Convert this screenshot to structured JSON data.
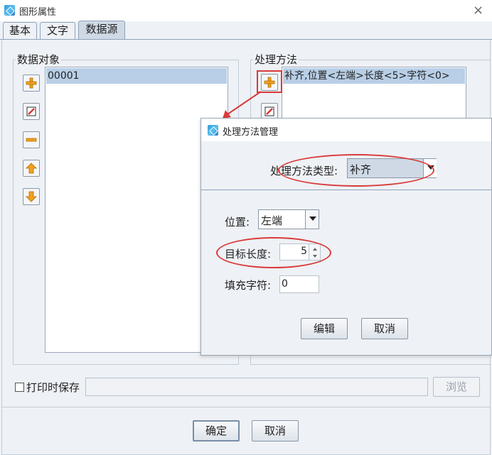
{
  "window": {
    "title": "图形属性",
    "close": "×"
  },
  "tabs": [
    {
      "label": "基本",
      "active": false
    },
    {
      "label": "文字",
      "active": false
    },
    {
      "label": "数据源",
      "active": true
    }
  ],
  "data_object": {
    "label": "数据对象",
    "items": [
      "00001"
    ]
  },
  "process_method": {
    "label": "处理方法",
    "items": [
      "补齐,位置<左端>长度<5>字符<0>"
    ]
  },
  "print_save": {
    "label": "打印时保存",
    "checked": false,
    "path": "",
    "browse_label": "浏览"
  },
  "footer": {
    "ok_label": "确定",
    "cancel_label": "取消"
  },
  "dialog": {
    "title": "处理方法管理",
    "type_label": "处理方法类型:",
    "type_value": "补齐",
    "position_label": "位置:",
    "position_value": "左端",
    "length_label": "目标长度:",
    "length_value": "5",
    "fill_label": "填充字符:",
    "fill_value": "0",
    "edit_label": "编辑",
    "cancel_label": "取消"
  },
  "colors": {
    "highlight": "#d93b3b",
    "selection": "#b8cfe7",
    "accent_icon": "#f0a020"
  }
}
